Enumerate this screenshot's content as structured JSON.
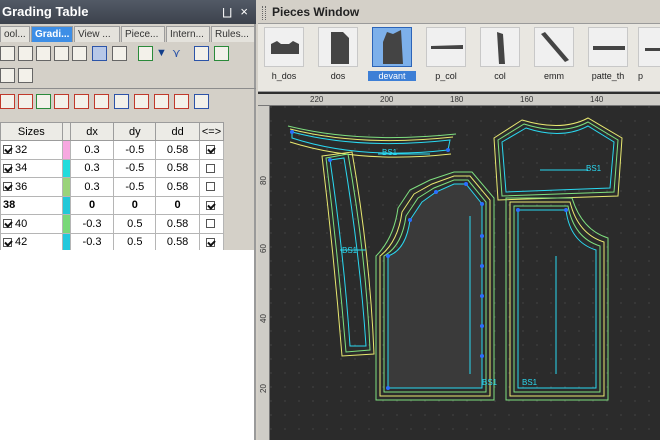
{
  "left_panel": {
    "title": "Grading Table",
    "pin_glyph": "⨆",
    "close_glyph": "×",
    "tabs": [
      {
        "label": "ool..."
      },
      {
        "label": "Gradi..."
      },
      {
        "label": "View ..."
      },
      {
        "label": "Piece..."
      },
      {
        "label": "Intern..."
      },
      {
        "label": "Rules..."
      }
    ],
    "table": {
      "headers": {
        "sizes": "Sizes",
        "dx": "dx",
        "dy": "dy",
        "dd": "dd",
        "sym": "<=>"
      },
      "rows": [
        {
          "size": "32",
          "dx": "0.3",
          "dy": "-0.5",
          "dd": "0.58",
          "color": "#f7a8e0",
          "checked": true,
          "flag": true
        },
        {
          "size": "34",
          "dx": "0.3",
          "dy": "-0.5",
          "dd": "0.58",
          "color": "#22dcdc",
          "checked": true,
          "flag": false
        },
        {
          "size": "36",
          "dx": "0.3",
          "dy": "-0.5",
          "dd": "0.58",
          "color": "#9ad37a",
          "checked": true,
          "flag": false
        },
        {
          "size": "38",
          "dx": "0",
          "dy": "0",
          "dd": "0",
          "color": "#22c8d8",
          "checked": false,
          "flag": true,
          "base": true
        },
        {
          "size": "40",
          "dx": "-0.3",
          "dy": "0.5",
          "dd": "0.58",
          "color": "#78d878",
          "checked": true,
          "flag": false
        },
        {
          "size": "42",
          "dx": "-0.3",
          "dy": "0.5",
          "dd": "0.58",
          "color": "#22c8dc",
          "checked": true,
          "flag": true
        }
      ]
    }
  },
  "pieces_window": {
    "title": "Pieces Window",
    "pieces": [
      {
        "label": "h_dos"
      },
      {
        "label": "dos"
      },
      {
        "label": "devant",
        "selected": true
      },
      {
        "label": "p_col"
      },
      {
        "label": "col"
      },
      {
        "label": "emm"
      },
      {
        "label": "patte_th"
      },
      {
        "label": "p"
      }
    ]
  },
  "rulers": {
    "top": [
      "220",
      "200",
      "180",
      "160",
      "140"
    ],
    "left": [
      "80",
      "60",
      "40",
      "20"
    ]
  },
  "canvas": {
    "labels": [
      "BS1",
      "BS1",
      "BS1",
      "BS1",
      "BS1"
    ]
  },
  "colors": {
    "outline_cyan": "#2ad8f0",
    "grade_green": "#7fe07f",
    "grade_yellow": "#e8e870",
    "point_blue": "#2a6fff"
  }
}
